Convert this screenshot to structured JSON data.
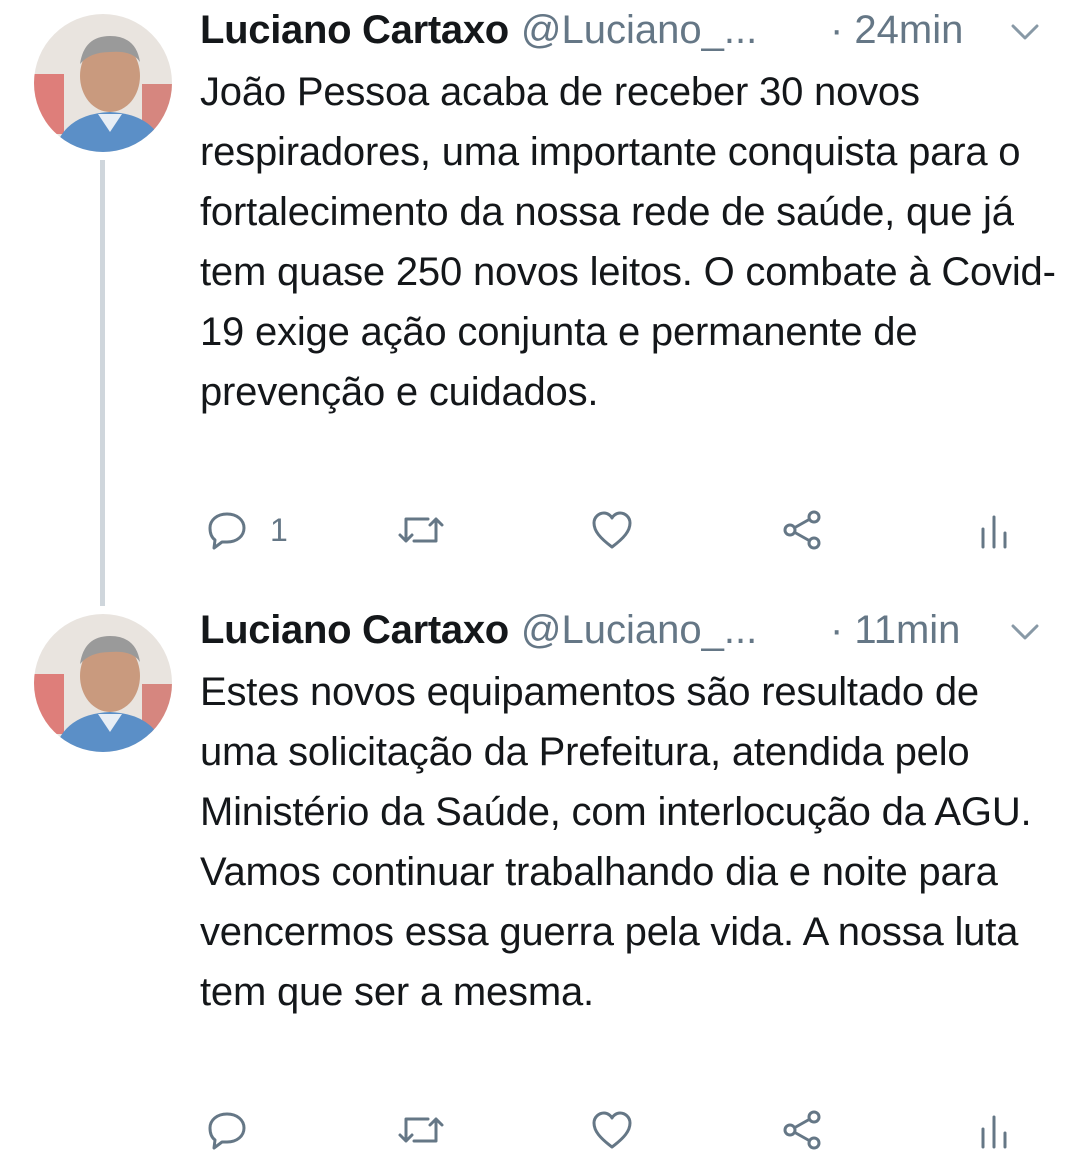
{
  "tweets": [
    {
      "author_name": "Luciano Cartaxo",
      "handle": "@Luciano_...",
      "time": "· 24min",
      "text": "João Pessoa acaba de receber 30 novos respiradores, uma importante conquista para o fortalecimento da nossa rede de saúde, que já tem quase 250 novos leitos. O combate à Covid-19 exige ação conjunta e permanente de prevenção e cuidados.",
      "reply_count": "1",
      "icons": [
        "reply-icon",
        "retweet-icon",
        "like-icon",
        "share-icon",
        "analytics-icon"
      ]
    },
    {
      "author_name": "Luciano Cartaxo",
      "handle": "@Luciano_...",
      "time": "· 11min",
      "text": "Estes novos equipamentos são resultado de uma solicitação da Prefeitura, atendida pelo Ministério da Saúde, com interlocução da AGU. Vamos continuar trabalhando dia e noite para vencermos essa guerra pela vida. A nossa luta tem que ser a mesma.",
      "reply_count": "",
      "icons": [
        "reply-icon",
        "retweet-icon",
        "like-icon",
        "share-icon",
        "analytics-icon"
      ]
    }
  ],
  "colors": {
    "text": "#14171a",
    "secondary": "#657786",
    "thread_line": "#cfd6dc",
    "background": "#ffffff"
  }
}
